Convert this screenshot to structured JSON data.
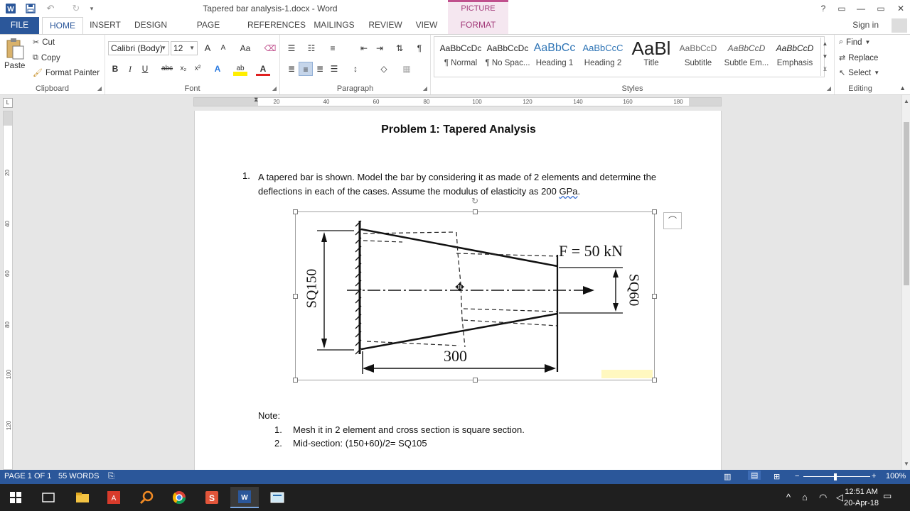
{
  "window": {
    "title": "Tapered bar analysis-1.docx - Word",
    "context_label": "PICTURE TOOLS",
    "help": "?",
    "restore_ribbon": "▭",
    "minimize": "—",
    "maximize": "▭",
    "close": "✕"
  },
  "quick_access": {
    "word_icon": "W",
    "save_icon": "save-icon",
    "undo": "↶",
    "redo": "↻",
    "customize": "▾"
  },
  "tabs": [
    "FILE",
    "HOME",
    "INSERT",
    "DESIGN",
    "PAGE LAYOUT",
    "REFERENCES",
    "MAILINGS",
    "REVIEW",
    "VIEW",
    "FORMAT"
  ],
  "account": {
    "signin": "Sign in"
  },
  "clipboard": {
    "paste": "Paste",
    "cut": "Cut",
    "copy": "Copy",
    "format_painter": "Format Painter",
    "label": "Clipboard"
  },
  "font": {
    "family": "Calibri (Body)",
    "size": "12",
    "grow": "A",
    "shrink": "A",
    "change_case": "Aa",
    "bold": "B",
    "italic": "I",
    "underline": "U",
    "strike": "abc",
    "subscript": "x₂",
    "superscript": "x²",
    "text_effects": "A",
    "highlight": "ab",
    "font_color": "A",
    "label": "Font"
  },
  "paragraph": {
    "label": "Paragraph"
  },
  "styles": {
    "label": "Styles",
    "items": [
      {
        "preview": "AaBbCcDc",
        "name": "¶ Normal"
      },
      {
        "preview": "AaBbCcDc",
        "name": "¶ No Spac..."
      },
      {
        "preview": "AaBbCc",
        "name": "Heading 1"
      },
      {
        "preview": "AaBbCcC",
        "name": "Heading 2"
      },
      {
        "preview": "AaBl",
        "name": "Title"
      },
      {
        "preview": "AaBbCcD",
        "name": "Subtitle"
      },
      {
        "preview": "AaBbCcD",
        "name": "Subtle Em..."
      },
      {
        "preview": "AaBbCcD",
        "name": "Emphasis"
      }
    ]
  },
  "editing": {
    "find": "Find",
    "replace": "Replace",
    "select": "Select",
    "label": "Editing"
  },
  "ruler": {
    "marks": [
      "20",
      "40",
      "60",
      "80",
      "100",
      "120",
      "140",
      "160",
      "180"
    ],
    "vertical_marks": [
      "20",
      "40",
      "60",
      "80",
      "100",
      "120"
    ]
  },
  "document": {
    "heading": "Problem 1: Tapered Analysis",
    "list_number": "1.",
    "paragraph_text_a": "A tapered bar is shown. Model the bar by considering it as made of 2 elements and determine the deflections in each of the cases. Assume the modulus of elasticity as 200 ",
    "paragraph_err": "GPa",
    "paragraph_end": ".",
    "figure_labels": {
      "force": "F = 50 kN",
      "left_section": "SQ150",
      "right_section": "SQ60",
      "length": "300"
    },
    "note_label": "Note:",
    "notes": [
      {
        "num": "1.",
        "text": "Mesh it in 2 element and cross section is square section."
      },
      {
        "num": "2.",
        "text": "Mid-section: (150+60)/2=  SQ105"
      }
    ]
  },
  "statusbar": {
    "page": "PAGE 1 OF 1",
    "words": "55 WORDS",
    "zoom": "100%"
  },
  "taskbar": {
    "time": "12:51 AM",
    "date": "20-Apr-18"
  },
  "colors": {
    "word_blue": "#2b579a",
    "format_pink": "#a33b7a"
  }
}
